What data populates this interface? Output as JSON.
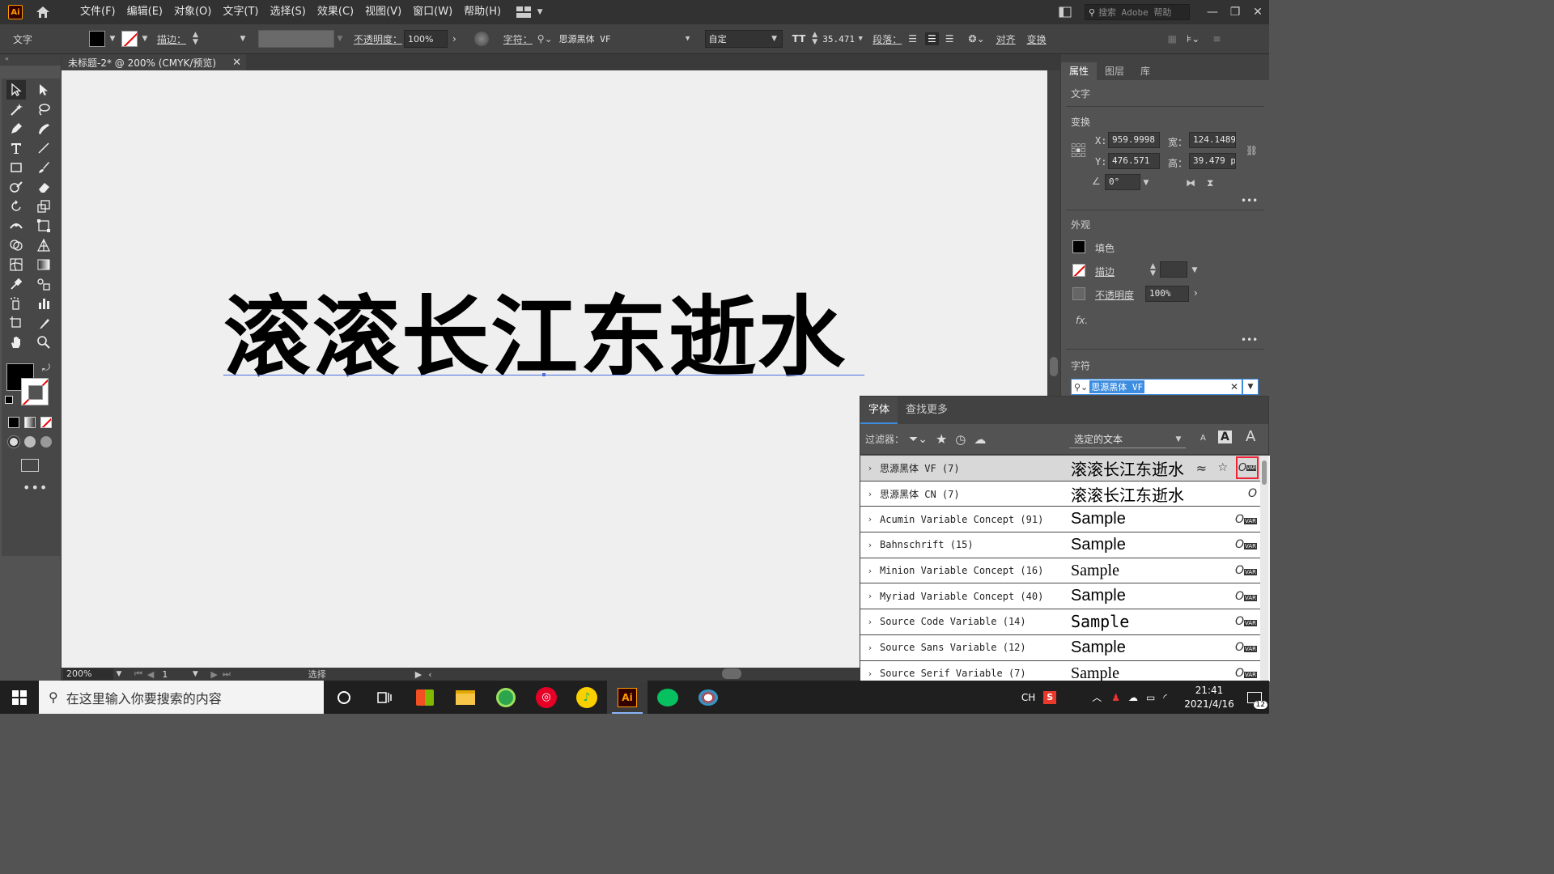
{
  "menubar": {
    "items": [
      "文件(F)",
      "编辑(E)",
      "对象(O)",
      "文字(T)",
      "选择(S)",
      "效果(C)",
      "视图(V)",
      "窗口(W)",
      "帮助(H)"
    ],
    "search_placeholder": "搜索 Adobe 帮助",
    "logo": "Ai"
  },
  "controlbar": {
    "tool_name": "文字",
    "stroke_label": "描边：",
    "opacity_label": "不透明度：",
    "opacity_value": "100%",
    "char_label": "字符：",
    "font_value": "思源黑体 VF",
    "style_value": "自定",
    "size_value": "35.471",
    "para_label": "段落：",
    "align_label": "对齐",
    "transform_label": "变换"
  },
  "tab": {
    "title": "未标题-2* @ 200% (CMYK/预览)"
  },
  "canvas": {
    "text": "滚滚长江东逝水"
  },
  "statusbar": {
    "zoom": "200%",
    "page": "1",
    "tool": "选择"
  },
  "rightpanel": {
    "tabs": [
      "属性",
      "图层",
      "库"
    ],
    "section_type": "文字",
    "section_transform": "变换",
    "x_label": "X:",
    "x_value": "959.9998",
    "y_label": "Y:",
    "y_value": "476.571",
    "w_label": "宽：",
    "w_value": "124.1489",
    "h_label": "高：",
    "h_value": "39.479 p",
    "angle_value": "0°",
    "section_appearance": "外观",
    "fill_label": "填色",
    "stroke_label": "描边",
    "opacity_label": "不透明度",
    "opacity_value": "100%",
    "fx_label": "fx.",
    "section_char": "字符",
    "font_field": "思源黑体 VF"
  },
  "fontpopup": {
    "tabs": [
      "字体",
      "查找更多"
    ],
    "filter_label": "过滤器：",
    "sample_select": "选定的文本",
    "fonts": [
      {
        "name": "思源黑体 VF (7)",
        "sample": "滚滚长江东逝水"
      },
      {
        "name": "思源黑体 CN (7)",
        "sample": "滚滚长江东逝水"
      },
      {
        "name": "Acumin Variable Concept (91)",
        "sample": "Sample"
      },
      {
        "name": "Bahnschrift (15)",
        "sample": "Sample"
      },
      {
        "name": "Minion Variable Concept (16)",
        "sample": "Sample"
      },
      {
        "name": "Myriad Variable Concept (40)",
        "sample": "Sample"
      },
      {
        "name": "Source Code Variable (14)",
        "sample": "Sample"
      },
      {
        "name": "Source Sans Variable (12)",
        "sample": "Sample"
      },
      {
        "name": "Source Serif Variable (7)",
        "sample": "Sample"
      }
    ]
  },
  "taskbar": {
    "search_placeholder": "在这里输入你要搜索的内容",
    "lang": "CH",
    "time": "21:41",
    "date": "2021/4/16",
    "notif_count": "12",
    "ai_label": "Ai"
  },
  "colors": {
    "accent": "#3c8ce0",
    "ai_orange": "#ff9a00",
    "panel": "#535353"
  }
}
